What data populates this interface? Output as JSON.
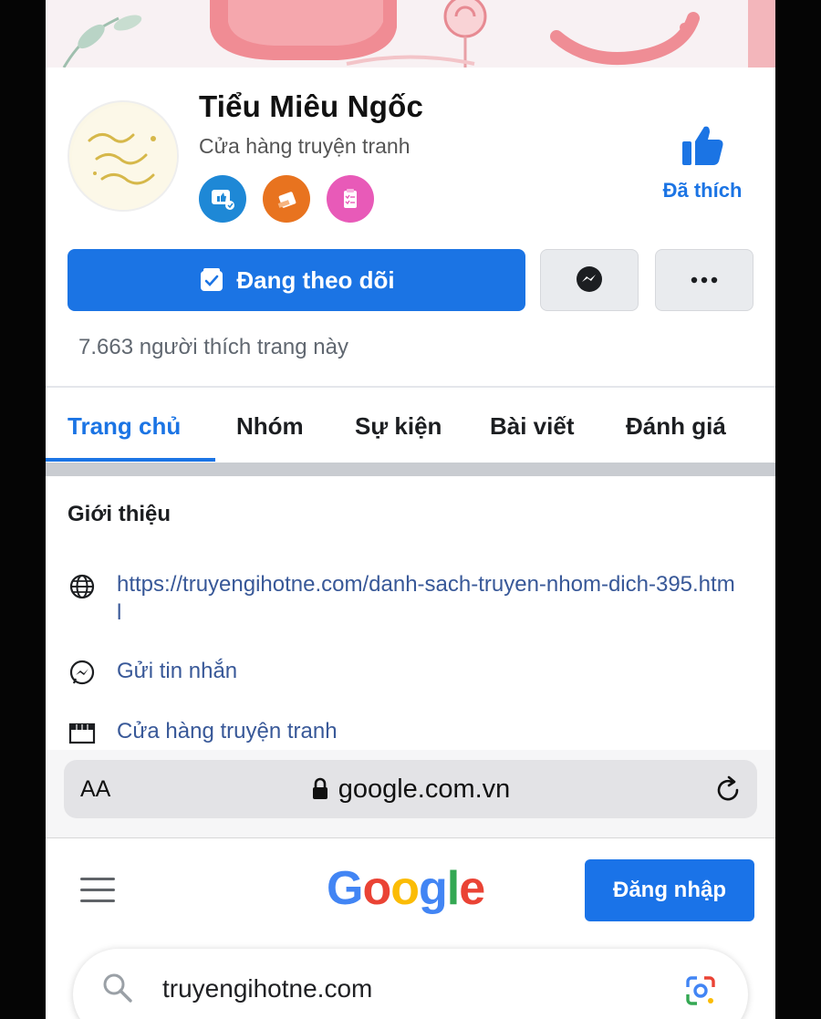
{
  "page": {
    "name": "Tiểu Miêu Ngốc",
    "category": "Cửa hàng truyện tranh",
    "avatar_text": "Tiểu Miêu Ngốc",
    "liked_label": "Đã thích",
    "follow_label": "Đang theo dõi",
    "likes_count": "7.663 người thích trang này"
  },
  "tabs": [
    {
      "label": "Trang chủ",
      "active": true
    },
    {
      "label": "Nhóm",
      "active": false
    },
    {
      "label": "Sự kiện",
      "active": false
    },
    {
      "label": "Bài viết",
      "active": false
    },
    {
      "label": "Đánh giá",
      "active": false
    }
  ],
  "intro": {
    "title": "Giới thiệu",
    "website": "https://truyengihotne.com/danh-sach-truyen-nhom-dich-395.html",
    "message": "Gửi tin nhắn",
    "category": "Cửa hàng truyện tranh"
  },
  "browser": {
    "text_size_label": "AA",
    "url": "google.com.vn"
  },
  "google": {
    "logo_letters": [
      "G",
      "o",
      "o",
      "g",
      "l",
      "e"
    ],
    "logo_colors": [
      "#4285F4",
      "#EA4335",
      "#FBBC05",
      "#4285F4",
      "#34A853",
      "#EA4335"
    ],
    "login_label": "Đăng nhập",
    "search_query": "truyengihotne.com"
  },
  "colors": {
    "facebook_blue": "#1b74e4",
    "link_blue": "#385898",
    "google_blue": "#1a73e8"
  }
}
